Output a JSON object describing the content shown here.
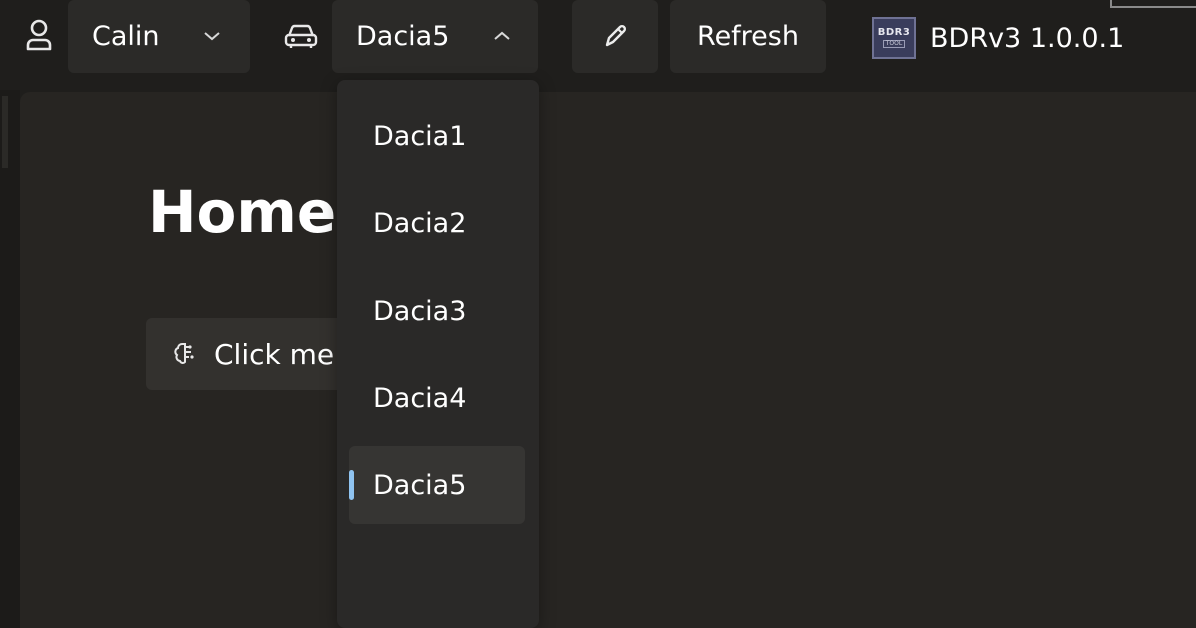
{
  "topbar": {
    "user_label": "Calin",
    "car_label": "Dacia5",
    "refresh_label": "Refresh",
    "brand": {
      "logo_line1": "BDR3",
      "logo_line2": "TOOL",
      "text": "BDRv3 1.0.0.1"
    }
  },
  "main": {
    "title": "Home",
    "click_button_label": "Click me"
  },
  "dropdown": {
    "items": [
      {
        "label": "Dacia1"
      },
      {
        "label": "Dacia2"
      },
      {
        "label": "Dacia3"
      },
      {
        "label": "Dacia4"
      },
      {
        "label": "Dacia5"
      }
    ],
    "selected": "Dacia5"
  },
  "icons": {
    "user": "person-icon",
    "car": "car-icon",
    "edit": "pencil-icon",
    "click": "brain-icon",
    "user_chevron": "chevron-down-icon",
    "car_chevron": "chevron-up-icon"
  },
  "colors": {
    "accent": "#8fc3f0",
    "background": "#1f1e1c",
    "panel": "#272522",
    "button": "#2b2a28"
  }
}
